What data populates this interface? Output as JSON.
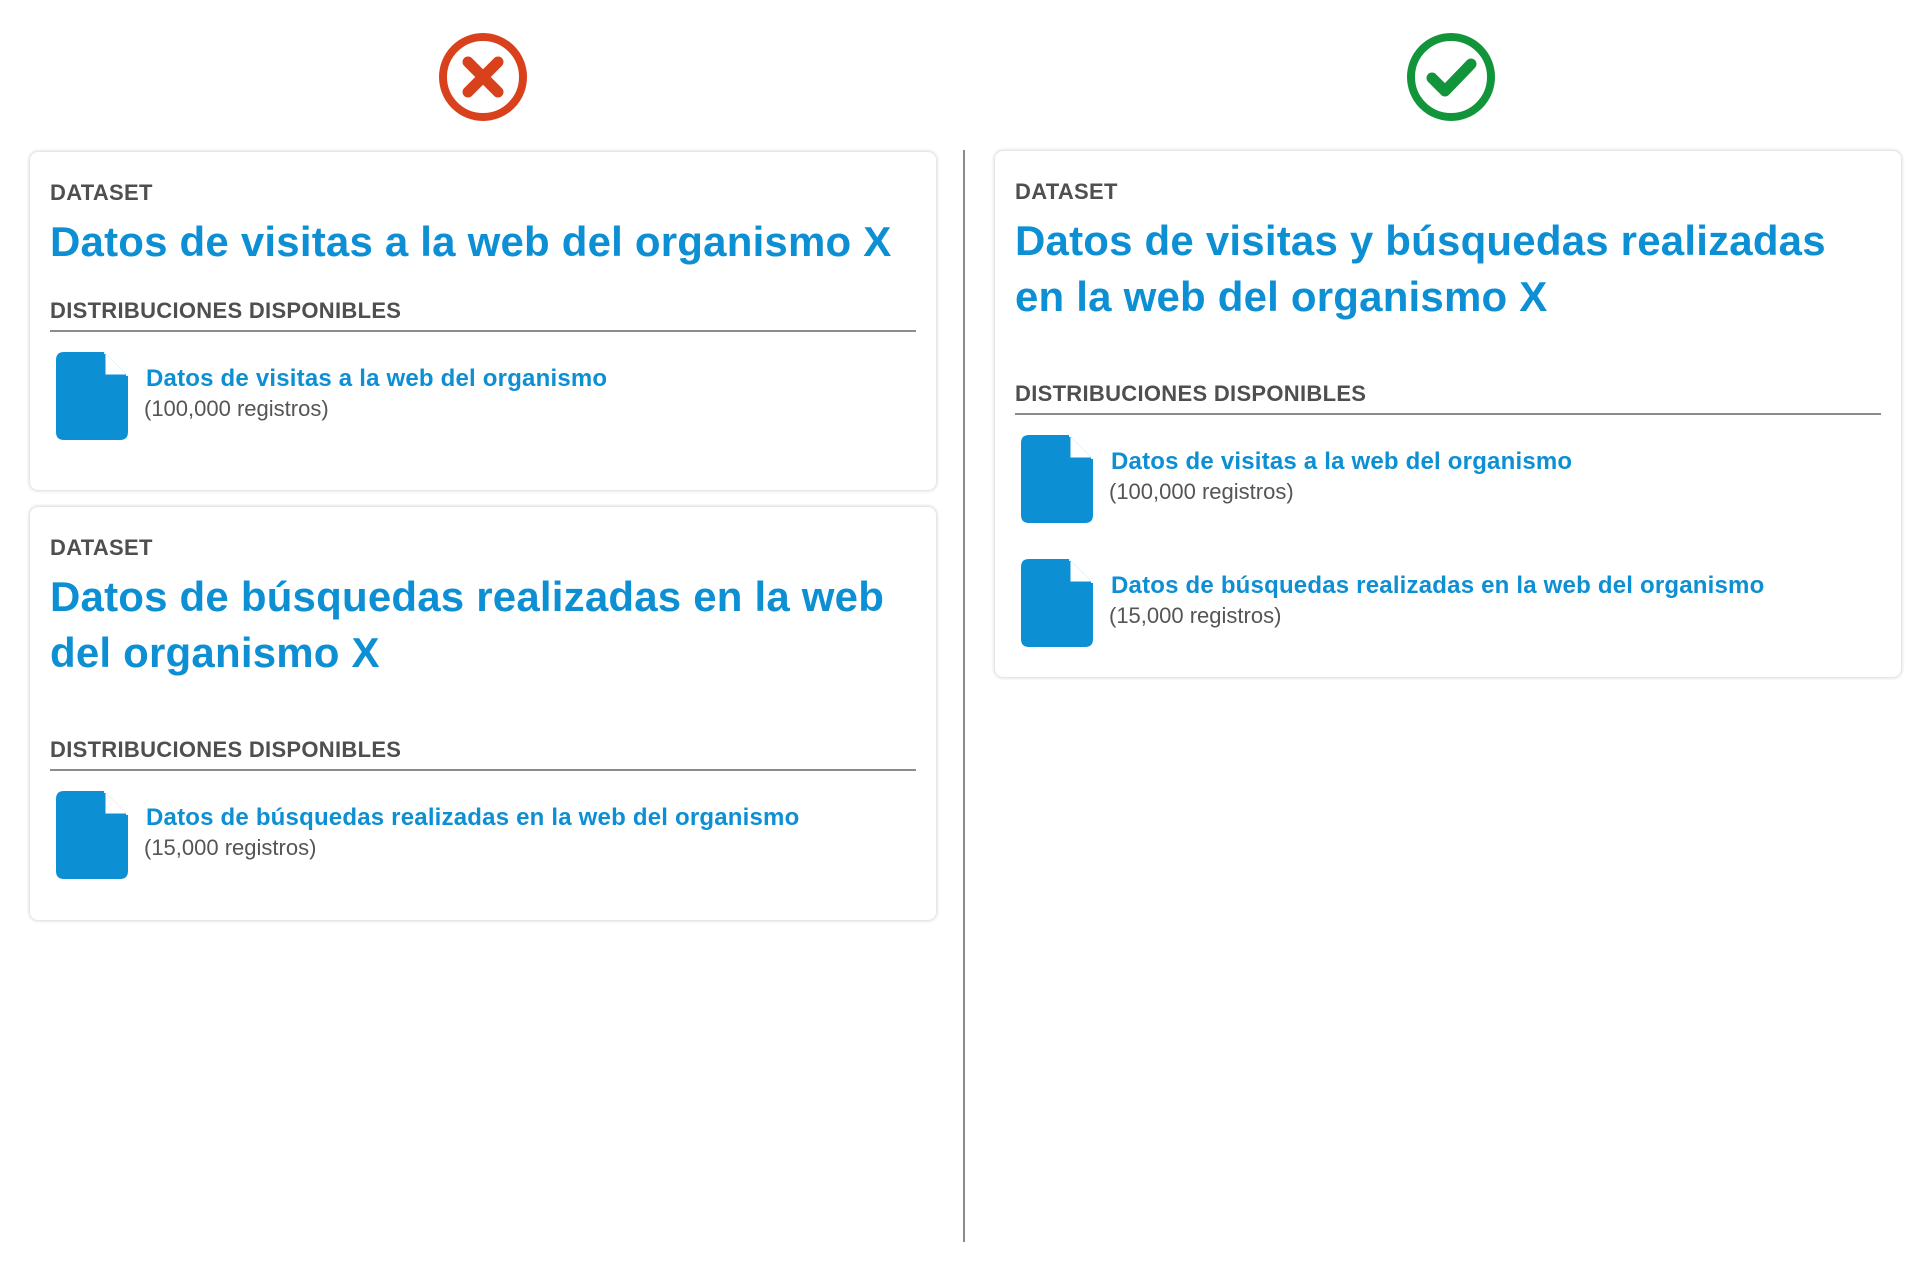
{
  "colors": {
    "accent": "#0d8fd4",
    "wrong": "#d9411c",
    "right": "#12953a",
    "muted_text": "#4f4f4f",
    "rule": "#8c8c8c"
  },
  "wrong_example": {
    "mark_icon": "cross-circle-icon",
    "datasets": [
      {
        "kicker": "DATASET",
        "title": "Datos de visitas a la web del organismo X",
        "distributions_heading": "DISTRIBUCIONES DISPONIBLES",
        "distributions": [
          {
            "icon": "file-icon",
            "name": "Datos de visitas a la web del organismo",
            "count": "(100,000 registros)"
          }
        ]
      },
      {
        "kicker": "DATASET",
        "title": "Datos de búsquedas realizadas en la web del organismo X",
        "distributions_heading": "DISTRIBUCIONES DISPONIBLES",
        "distributions": [
          {
            "icon": "file-icon",
            "name": "Datos de búsquedas realizadas en la web del organismo",
            "count": "(15,000 registros)"
          }
        ]
      }
    ]
  },
  "right_example": {
    "mark_icon": "check-circle-icon",
    "datasets": [
      {
        "kicker": "DATASET",
        "title": "Datos de visitas y búsquedas realizadas en la web del organismo X",
        "distributions_heading": "DISTRIBUCIONES DISPONIBLES",
        "distributions": [
          {
            "icon": "file-icon",
            "name": "Datos de visitas a la web del organismo",
            "count": "(100,000 registros)"
          },
          {
            "icon": "file-icon",
            "name": "Datos de búsquedas realizadas en la web del organismo",
            "count": "(15,000 registros)"
          }
        ]
      }
    ]
  }
}
